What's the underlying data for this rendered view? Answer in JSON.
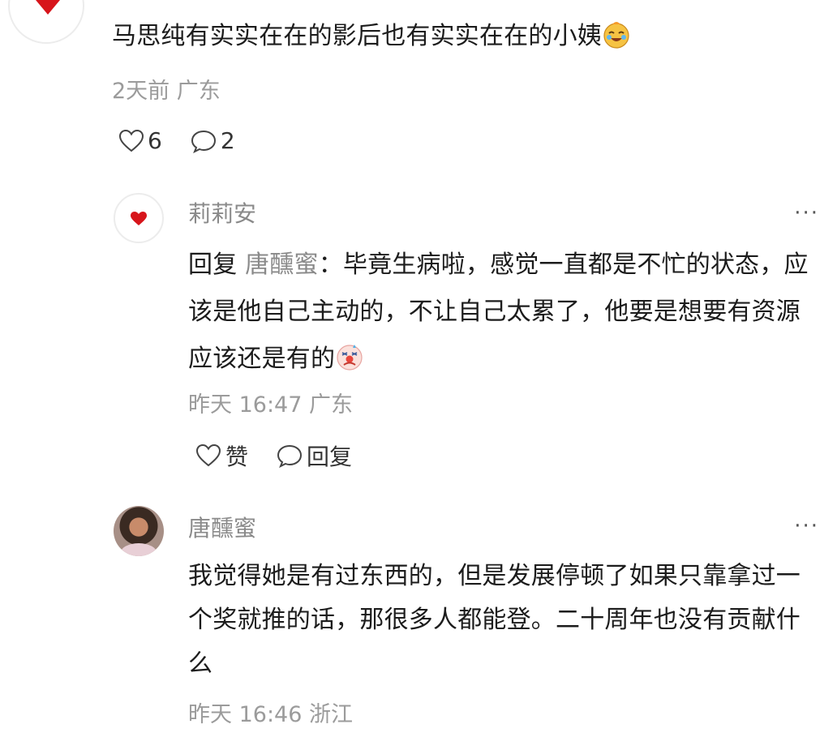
{
  "comment": {
    "text": "马思纯有实实在在的影后也有实实在在的小姨",
    "emoji": "laughing-tears-emoji",
    "time": "2天前",
    "location": "广东",
    "likes": "6",
    "replies": "2"
  },
  "reply1": {
    "username": "莉莉安",
    "more": "···",
    "prefix": "回复 ",
    "target": "唐醺蜜",
    "separator": "：",
    "text": "毕竟生病啦，感觉一直都是不忙的状态，应该是他自己主动的，不让自己太累了，他要是想要有资源应该还是有的",
    "emoji": "crying-clown-emoji",
    "time": "昨天 16:47",
    "location": "广东",
    "like_label": "赞",
    "reply_label": "回复"
  },
  "reply2": {
    "username": "唐醺蜜",
    "more": "···",
    "text": "我觉得她是有过东西的，但是发展停顿了如果只靠拿过一个奖就推的话，那很多人都能登。二十周年也没有贡献什么",
    "time": "昨天 16:46",
    "location": "浙江"
  },
  "colors": {
    "heart_red": "#d7151b",
    "meta_gray": "#9b9b9b",
    "name_gray": "#8a8a8a",
    "text_dark": "#1c1c1c"
  }
}
